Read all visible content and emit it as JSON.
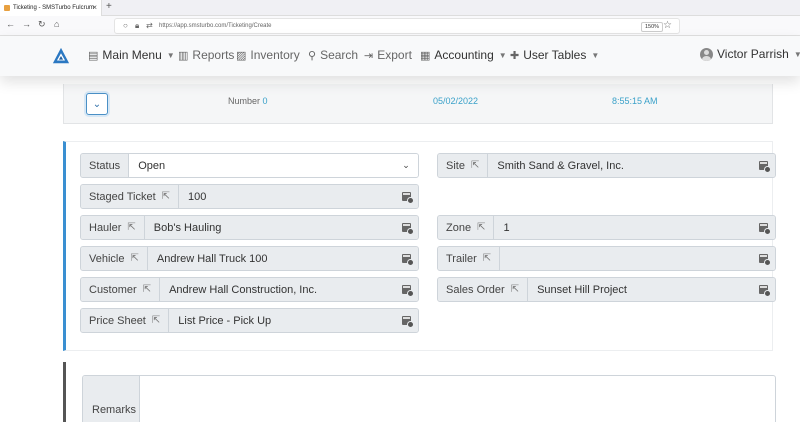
{
  "browser": {
    "tab_title": "Ticketing - SMSTurbo Fulcrum",
    "url": "https://app.smsturbo.com/Ticketing/Create",
    "zoom": "150%"
  },
  "header": {
    "main_menu": "Main Menu",
    "reports": "Reports",
    "inventory": "Inventory",
    "search": "Search",
    "export": "Export",
    "accounting": "Accounting",
    "user_tables": "User Tables",
    "user_name": "Victor Parrish"
  },
  "info": {
    "number_label": "Number",
    "number_value": "0",
    "date": "05/02/2022",
    "time": "8:55:15 AM"
  },
  "form": {
    "status": {
      "label": "Status",
      "value": "Open"
    },
    "staged_ticket": {
      "label": "Staged Ticket",
      "value": "100"
    },
    "hauler": {
      "label": "Hauler",
      "value": "Bob's Hauling"
    },
    "vehicle": {
      "label": "Vehicle",
      "value": "Andrew Hall Truck 100"
    },
    "customer": {
      "label": "Customer",
      "value": "Andrew Hall Construction, Inc."
    },
    "price_sheet": {
      "label": "Price Sheet",
      "value": "List Price - Pick Up"
    },
    "site": {
      "label": "Site",
      "value": "Smith Sand & Gravel, Inc."
    },
    "zone": {
      "label": "Zone",
      "value": "1"
    },
    "trailer": {
      "label": "Trailer",
      "value": ""
    },
    "sales_order": {
      "label": "Sales Order",
      "value": "Sunset Hill Project"
    }
  },
  "remarks": {
    "label": "Remarks"
  },
  "colors": {
    "accent": "#3a8fd1",
    "info_value": "#3aa1c9",
    "addon_bg": "#e9ecef"
  },
  "icons": {
    "external_link": "external-link-icon",
    "calculator": "calculator-icon",
    "chevron": "chevron-down-icon"
  }
}
